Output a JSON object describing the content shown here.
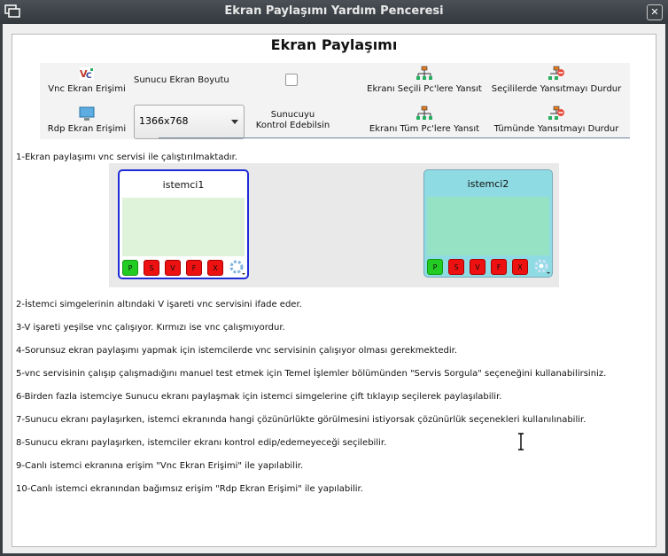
{
  "window": {
    "title": "Ekran Paylaşımı Yardım Penceresi"
  },
  "heading": "Ekran Paylaşımı",
  "toolbar": {
    "vnc_label": "Vnc Ekran Erişimi",
    "rdp_label": "Rdp Ekran Erişimi",
    "server_size_label": "Sunucu Ekran Boyutu",
    "resolution_value": "1366x768",
    "control_label_1": "Sunucuyu",
    "control_label_2": "Kontrol Edebilsin",
    "mirror_selected": "Ekranı Seçili Pc'lere Yansıt",
    "mirror_all": "Ekranı Tüm Pc'lere Yansıt",
    "stop_selected": "Seçililerde Yansıtmayı Durdur",
    "stop_all": "Tümünde Yansıtmayı Durdur"
  },
  "lines": {
    "l1": "1-Ekran paylaşımı vnc servisi ile çalıştırılmaktadır.",
    "l2": "2-İstemci simgelerinin altındaki V işareti vnc servisini ifade eder.",
    "l3": "3-V işareti yeşilse vnc çalışıyor. Kırmızı ise vnc çalışmıyordur.",
    "l4": "4-Sorunsuz ekran paylaşımı yapmak için istemcilerde vnc servisinin çalışıyor olması gerekmektedir.",
    "l5": "5-vnc servisinin çalışıp çalışmadığını manuel test etmek için Temel İşlemler bölümünden \"Servis Sorgula\" seçeneğini kullanabilirsiniz.",
    "l6": "6-Birden fazla istemciye Sunucu ekranı paylaşmak için istemci simgelerine çift tıklayıp seçilerek paylaşılabilir.",
    "l7": "7-Sunucu ekranı paylaşırken, istemci ekranında hangi çözünürlükte görülmesini istiyorsak çözünürlük seçenekleri kullanılınabilir.",
    "l8": "8-Sunucu ekranı paylaşırken, istemciler ekranı kontrol edip/edemeyeceği seçilebilir.",
    "l9": "9-Canlı istemci ekranına erişim \"Vnc Ekran Erişimi\" ile yapılabilir.",
    "l10": "10-Canlı istemci ekranından bağımsız erişim \"Rdp Ekran Erişimi\" ile yapılabilir."
  },
  "clients": [
    {
      "name": "istemci1",
      "buttons": [
        "P",
        "S",
        "V",
        "F",
        "X"
      ]
    },
    {
      "name": "istemci2",
      "buttons": [
        "P",
        "S",
        "V",
        "F",
        "X"
      ]
    }
  ],
  "colors": {
    "green": "#22cc22",
    "red": "#ee1111",
    "accent": "#1e2bd6"
  },
  "icons": [
    "vnc-icon",
    "rdp-icon",
    "network-icon",
    "network-stop-icon",
    "gear-icon",
    "close-icon",
    "text-cursor-icon"
  ]
}
